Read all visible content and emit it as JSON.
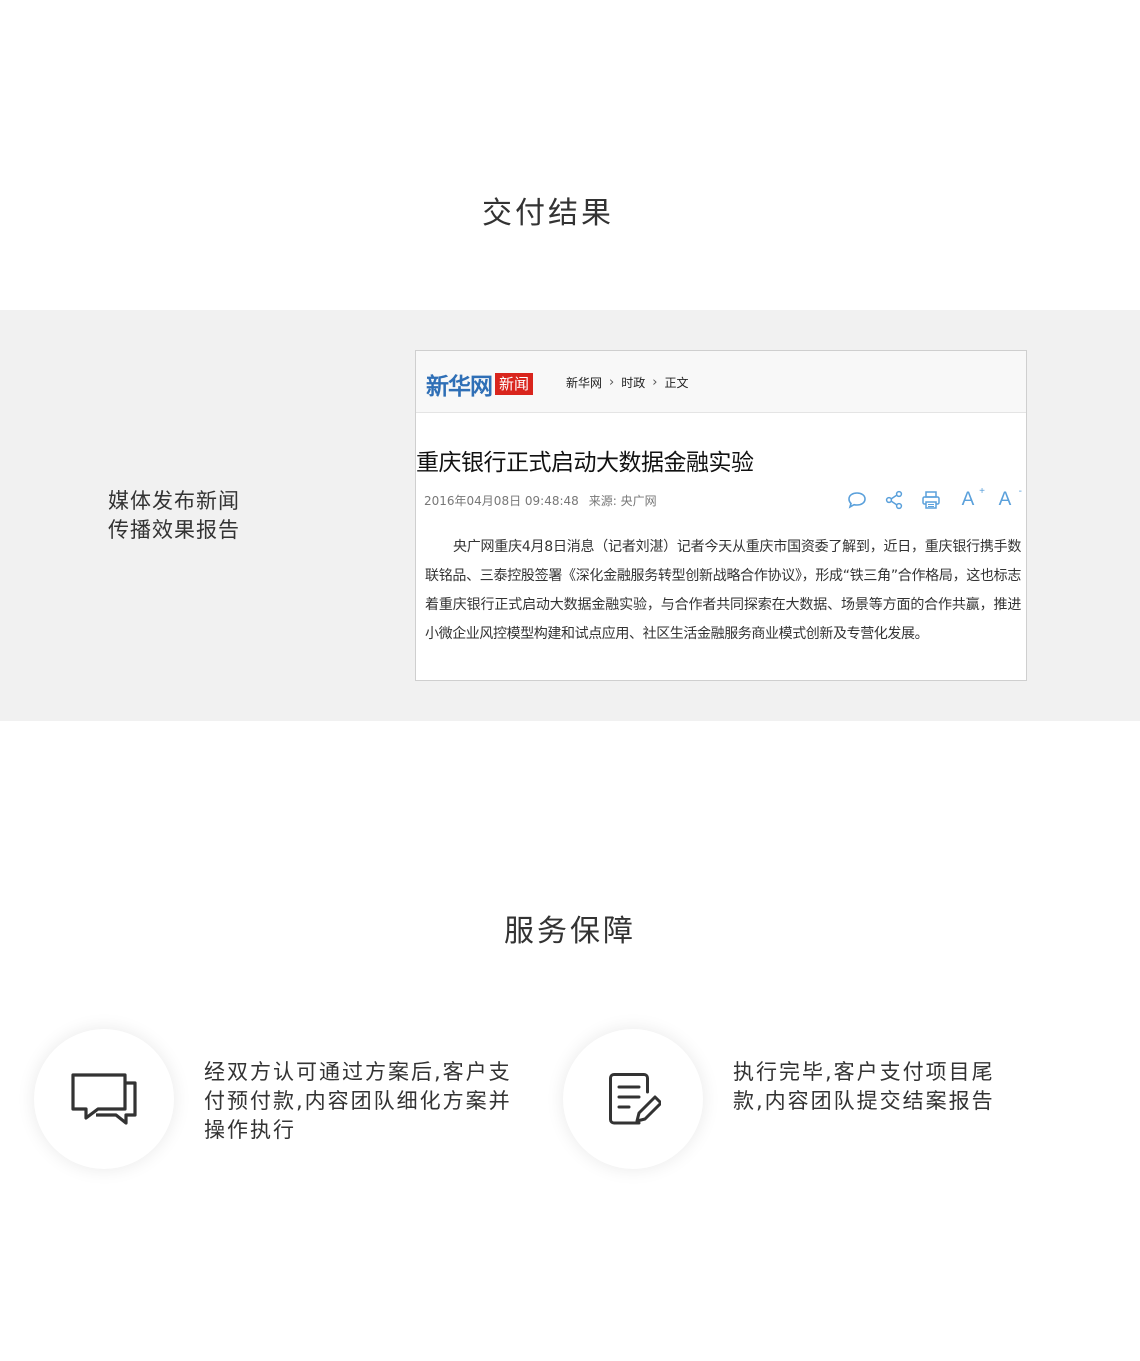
{
  "sections": {
    "delivery_title": "交付结果",
    "service_title": "服务保障"
  },
  "band": {
    "label_line1": "媒体发布新闻",
    "label_line2": "传播效果报告"
  },
  "news": {
    "logo_text": "新华网",
    "logo_badge": "新闻",
    "breadcrumb": [
      "新华网",
      "时政",
      "正文"
    ],
    "breadcrumb_sep": ">",
    "headline": "重庆银行正式启动大数据金融实验",
    "date": "2016年04月08日 09:48:48",
    "source": "来源: 央广网",
    "body": "央广网重庆4月8日消息（记者刘湛）记者今天从重庆市国资委了解到，近日，重庆银行携手数联铭品、三泰控股签署《深化金融服务转型创新战略合作协议》，形成“铁三角”合作格局，这也标志着重庆银行正式启动大数据金融实验，与合作者共同探索在大数据、场景等方面的合作共赢，推进小微企业风控模型构建和试点应用、社区生活金融服务商业模式创新及专营化发展。",
    "tools": [
      "comment-icon",
      "share-icon",
      "print-icon",
      "font-larger-icon",
      "font-smaller-icon"
    ],
    "font_larger": "A",
    "font_larger_sup": "+",
    "font_smaller": "A",
    "font_smaller_sup": "-",
    "accent": "#5aa0db",
    "logo_color": "#2f6fb6",
    "badge_color": "#d9251d"
  },
  "service": [
    {
      "icon": "chat-bubbles-icon",
      "text": "经双方认可通过方案后,客户支付预付款,内容团队细化方案并操作执行"
    },
    {
      "icon": "document-edit-icon",
      "text": "执行完毕,客户支付项目尾款,内容团队提交结案报告"
    }
  ]
}
